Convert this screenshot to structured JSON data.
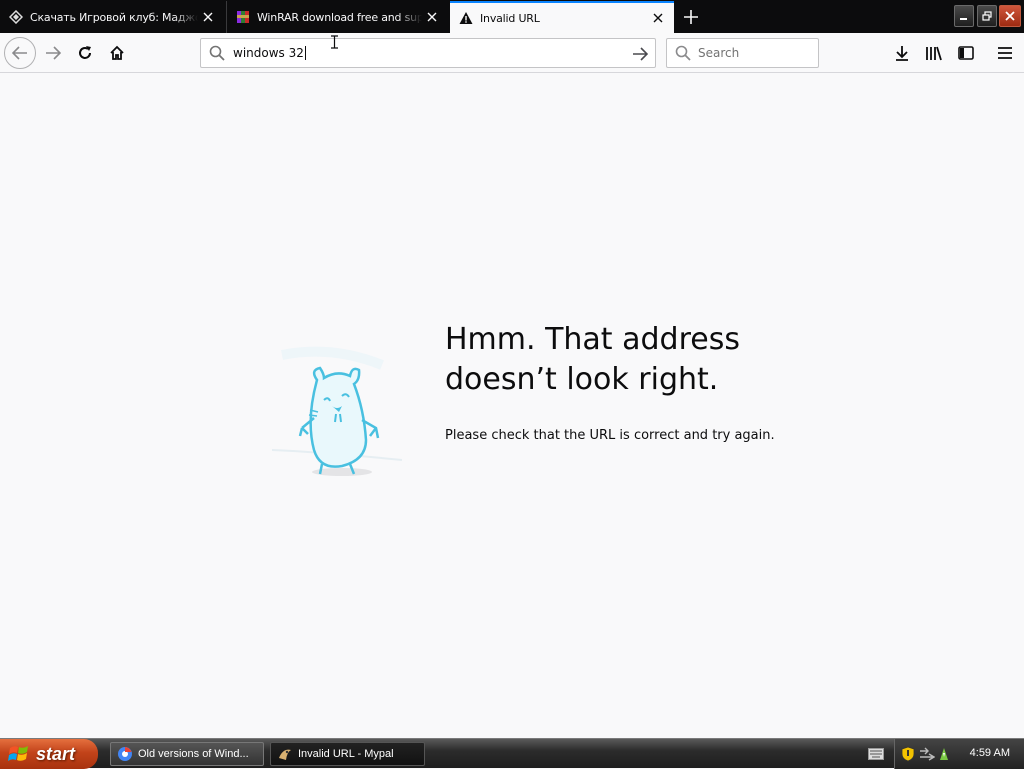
{
  "tabs": [
    {
      "title": "Скачать Игровой клуб: Маджонг",
      "favicon": "site-icon"
    },
    {
      "title": "WinRAR download free and support",
      "favicon": "winrar-icon"
    },
    {
      "title": "Invalid URL",
      "favicon": "warning-icon",
      "active": true
    }
  ],
  "urlbar": {
    "value": "windows 32"
  },
  "search": {
    "placeholder": "Search"
  },
  "error_page": {
    "heading_line1": "Hmm. That address",
    "heading_line2": "doesn’t look right.",
    "message": "Please check that the URL is correct and try again."
  },
  "taskbar": {
    "start_label": "start",
    "tasks": [
      {
        "label": "Old versions of Wind...",
        "icon": "browser-icon"
      },
      {
        "label": "Invalid URL - Mypal",
        "icon": "mypal-icon",
        "active": true
      }
    ],
    "clock": "4:59 AM"
  },
  "colors": {
    "accent": "#0a84ff",
    "start_button": "#c2431a",
    "tab_strip": "#0c0c0d"
  }
}
